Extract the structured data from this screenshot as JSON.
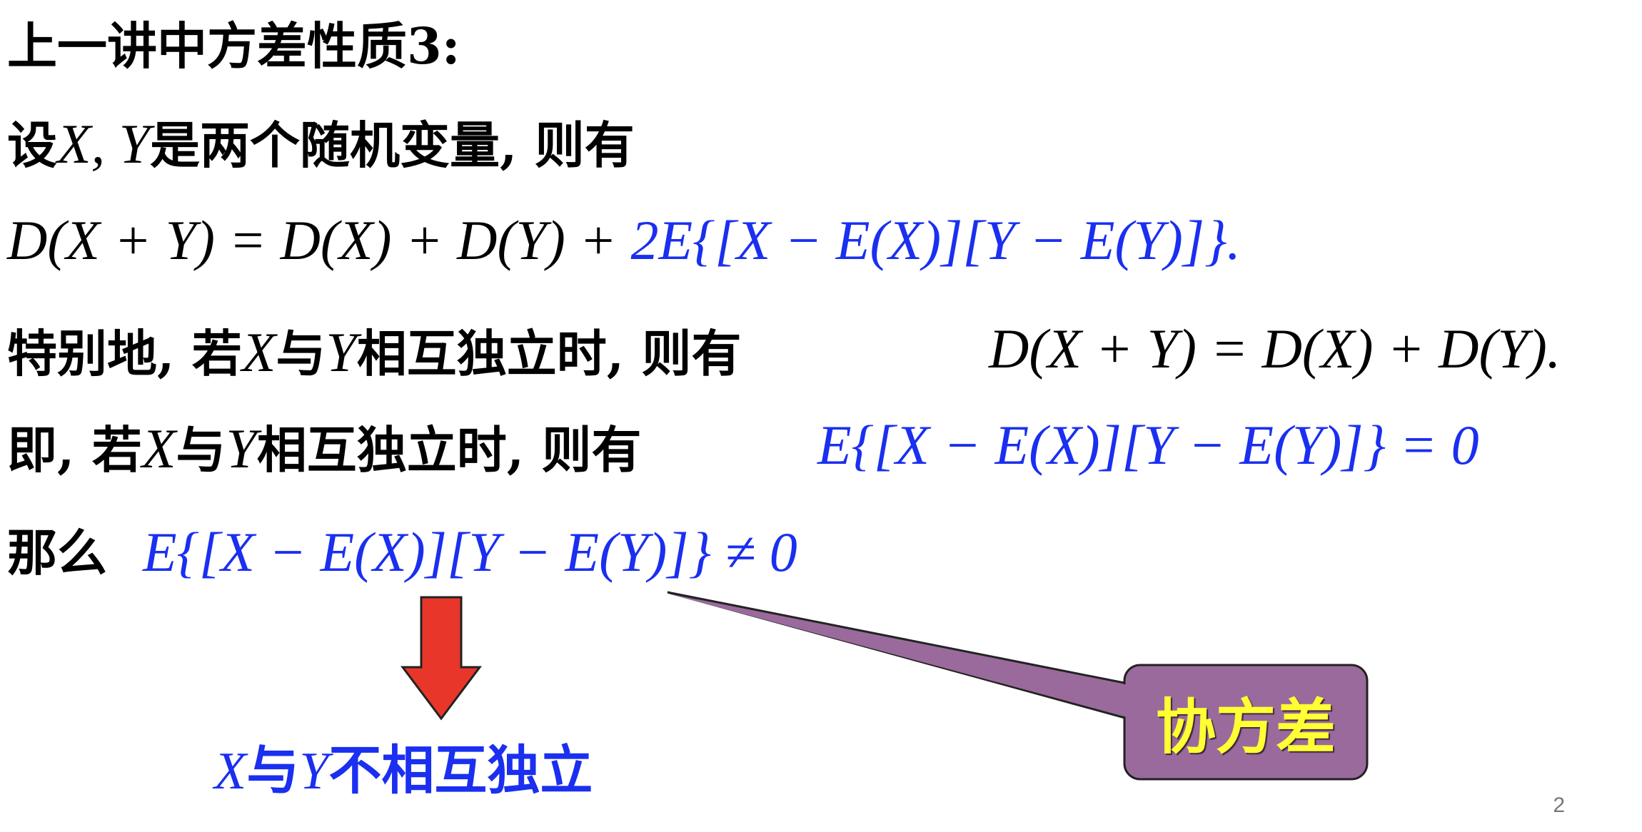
{
  "lines": {
    "l1": "上一讲中方差性质3:",
    "l2_pre": "设",
    "l2_mid": "X, Y",
    "l2_post": "是两个随机变量, 则有",
    "l3_black": "D(X + Y) = D(X) + D(Y) + ",
    "l3_blue": "2E{[X − E(X)][Y − E(Y)]}.",
    "l4_pre": "特别地, 若",
    "l4_x": "X",
    "l4_mid": "与",
    "l4_y": "Y",
    "l4_post": "相互独立时, 则有",
    "l4_math": "D(X + Y) = D(X) + D(Y).",
    "l5_pre": "即, 若",
    "l5_x": "X",
    "l5_mid": "与",
    "l5_y": "Y",
    "l5_post": "相互独立时, 则有",
    "l5_math": "E{[X − E(X)][Y − E(Y)]} = 0",
    "l6_pre": "那么",
    "l6_math": "E{[X − E(X)][Y − E(Y)]} ≠ 0"
  },
  "note": {
    "x": "X",
    "mid": "与",
    "y": "Y",
    "post": "不相互独立"
  },
  "callout": {
    "label": "协方差"
  },
  "page_number": "2",
  "colors": {
    "blue_text": "#1a2ff0",
    "arrow_red": "#e8372a",
    "callout_fill": "#9a6a9c",
    "callout_text": "#ffff33"
  }
}
